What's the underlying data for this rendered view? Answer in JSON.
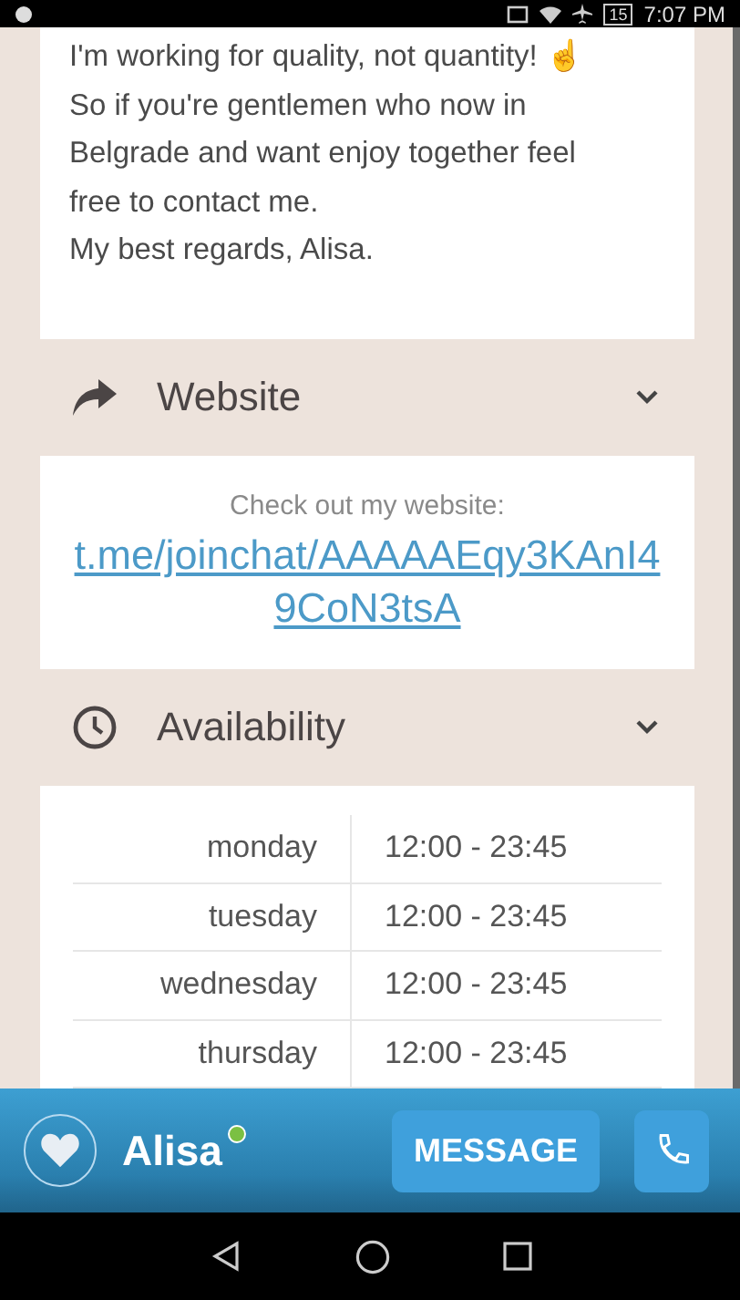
{
  "status_bar": {
    "time": "7:07 PM",
    "battery": "15"
  },
  "about": {
    "lines": [
      "I'm working for quality, not quantity! ☝",
      "So if you're gentlemen who now in",
      "Belgrade and want enjoy together feel",
      "free to contact me.",
      "My best regards, Alisa."
    ]
  },
  "website": {
    "title": "Website",
    "expanded": true,
    "intro": "Check out my website:",
    "link": "t.me/joinchat/AAAAAEqy3KAnI49CoN3tsA"
  },
  "availability": {
    "title": "Availability",
    "expanded": true,
    "rows": [
      {
        "day": "monday",
        "hours": "12:00 - 23:45"
      },
      {
        "day": "tuesday",
        "hours": "12:00 - 23:45"
      },
      {
        "day": "wednesday",
        "hours": "12:00 - 23:45"
      },
      {
        "day": "thursday",
        "hours": "12:00 - 23:45"
      }
    ]
  },
  "profile_bar": {
    "name": "Alisa",
    "online": true,
    "favorite": false,
    "message_button": "MESSAGE"
  }
}
